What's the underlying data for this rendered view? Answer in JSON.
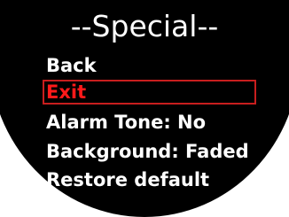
{
  "screen": {
    "title": "--Special--"
  },
  "menu": {
    "items": [
      {
        "label": "Back"
      },
      {
        "label": "Exit"
      },
      {
        "label": "Alarm Tone: No"
      },
      {
        "label": "Background: Faded"
      },
      {
        "label": "Restore default"
      }
    ],
    "selected_index": 1
  },
  "colors": {
    "background": "#000000",
    "text": "#ffffff",
    "selected_text": "#ff1a1a",
    "selection_border": "#c81e1e"
  }
}
